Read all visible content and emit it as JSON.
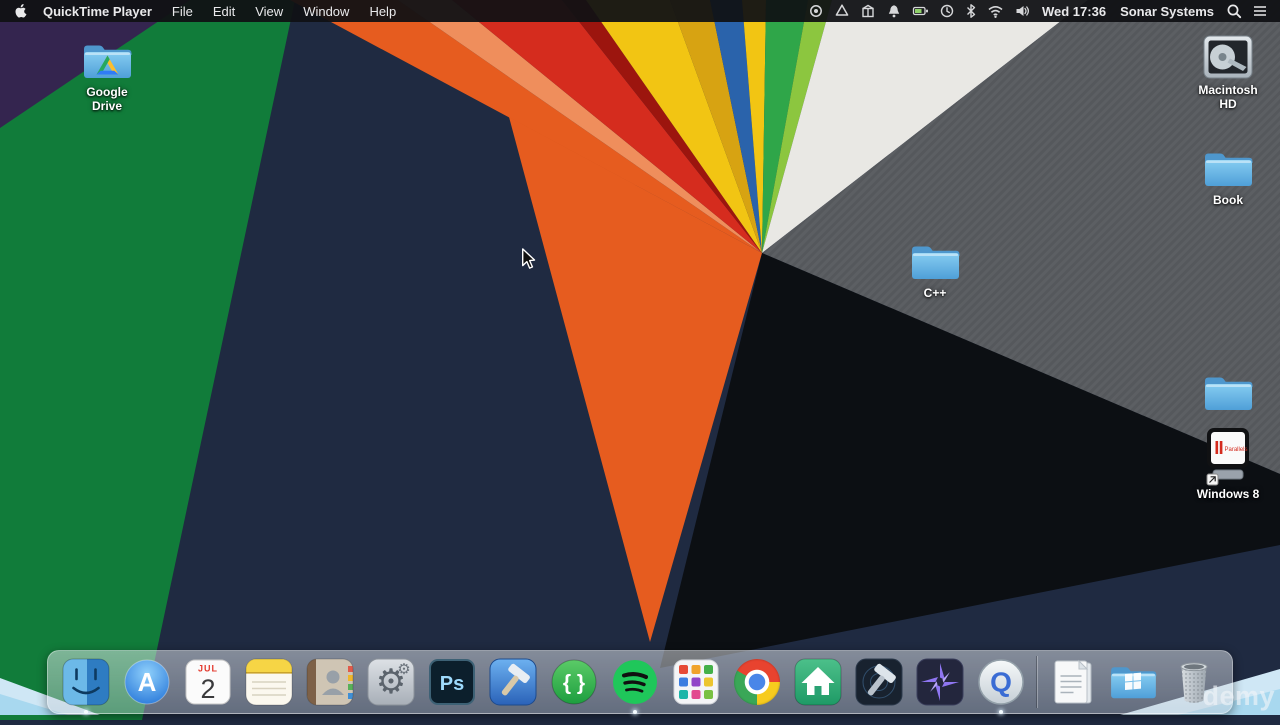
{
  "menu_bar": {
    "app_name": "QuickTime Player",
    "menus": [
      "File",
      "Edit",
      "View",
      "Window",
      "Help"
    ],
    "date_time": "Wed 17:36",
    "user_name": "Sonar Systems",
    "status_icons": [
      "screen-recording",
      "google-drive",
      "package",
      "notifications",
      "battery",
      "time-machine",
      "bluetooth",
      "wifi",
      "volume",
      "spotlight",
      "notification-center"
    ]
  },
  "desktop_icons": {
    "google_drive": {
      "label": "Google Drive"
    },
    "macintosh_hd": {
      "label": "Macintosh HD"
    },
    "book": {
      "label": "Book"
    },
    "cpp": {
      "label": "C++"
    },
    "spare_folder": {
      "label": ""
    },
    "windows8": {
      "label": "Windows 8",
      "badge_text": "Parallels"
    }
  },
  "dock": {
    "app_store_letter": "A",
    "calendar": {
      "month": "JUL",
      "day": "2"
    },
    "ps_letters": "Ps",
    "braces_label": "{ }",
    "qt_letter": "Q",
    "items": [
      {
        "name": "finder",
        "running": true
      },
      {
        "name": "app-store",
        "running": false
      },
      {
        "name": "calendar",
        "running": false
      },
      {
        "name": "notes",
        "running": false
      },
      {
        "name": "contacts",
        "running": false
      },
      {
        "name": "system-preferences",
        "running": false
      },
      {
        "name": "photoshop",
        "running": false
      },
      {
        "name": "xcode",
        "running": false
      },
      {
        "name": "code-braces",
        "running": false
      },
      {
        "name": "spotify",
        "running": true
      },
      {
        "name": "grid-app",
        "running": false
      },
      {
        "name": "chrome",
        "running": false
      },
      {
        "name": "home-app",
        "running": false
      },
      {
        "name": "xcode-dark",
        "running": false
      },
      {
        "name": "star-app",
        "running": false
      },
      {
        "name": "quicktime",
        "running": true
      },
      {
        "name": "documents",
        "running": false
      },
      {
        "name": "windows-folder",
        "running": false
      },
      {
        "name": "trash",
        "running": false
      }
    ]
  },
  "watermark": "demy",
  "wallpaper_colors": {
    "base": "#1f2a41",
    "purple": "#34254f",
    "green": "#117c3a",
    "orange": "#e65c1f",
    "salmon": "#ef8e5c",
    "red": "#d52c1e",
    "dark_red": "#9c150e",
    "yellow": "#f2c513",
    "gold": "#d7a312",
    "blue": "#2a63ab",
    "stripe_green": "#2fa649",
    "stripe_green_light": "#8cc63f",
    "white": "#e9e8e4",
    "gray": "#55585c",
    "black": "#0c0f13"
  }
}
